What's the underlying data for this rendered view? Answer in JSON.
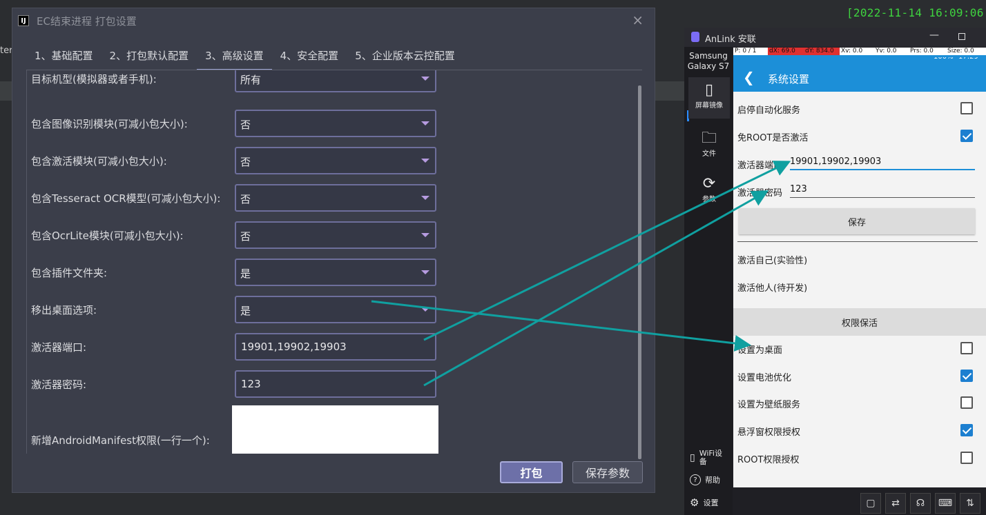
{
  "background": {
    "left_text": "ter",
    "timestamp": "[2022-11-14 16:09:06"
  },
  "dialog": {
    "icon_letter": "IJ",
    "title": "EC结束进程 打包设置",
    "close": "×",
    "tabs": [
      {
        "label": "1、基础配置"
      },
      {
        "label": "2、打包默认配置"
      },
      {
        "label": "3、高级设置"
      },
      {
        "label": "4、安全配置"
      },
      {
        "label": "5、企业版本云控配置"
      }
    ],
    "fields": {
      "target": {
        "label": "目标机型(模拟器或者手机):",
        "value": "所有"
      },
      "image_module": {
        "label": "包含图像识别模块(可减小包大小):",
        "value": "否"
      },
      "activate_module": {
        "label": "包含激活模块(可减小包大小):",
        "value": "否"
      },
      "tesseract": {
        "label": "包含Tesseract OCR模型(可减小包大小):",
        "value": "否"
      },
      "ocrlite": {
        "label": "包含OcrLite模块(可减小包大小):",
        "value": "否"
      },
      "plugin_folder": {
        "label": "包含插件文件夹:",
        "value": "是"
      },
      "remove_desktop": {
        "label": "移出桌面选项:",
        "value": "是"
      },
      "activator_port": {
        "label": "激活器端口:",
        "value": "19901,19902,19903"
      },
      "activator_password": {
        "label": "激活器密码:",
        "value": "123"
      },
      "manifest": {
        "label": "新增AndroidManifest权限(一行一个):",
        "value": ""
      }
    },
    "buttons": {
      "pack": "打包",
      "save_params": "保存参数"
    }
  },
  "anlink": {
    "title": "AnLink 安联",
    "minimize": "—",
    "device_name": "Samsung Galaxy S7",
    "sidebar": [
      {
        "label": "屏幕镜像",
        "icon": "phone-icon"
      },
      {
        "label": "文件",
        "icon": "folder-icon"
      },
      {
        "label": "参数",
        "icon": "refresh-icon"
      }
    ],
    "sidebar_bottom": [
      {
        "label": "WiFi设备",
        "icon": "wifi-device-icon"
      },
      {
        "label": "帮助",
        "icon": "help-icon"
      },
      {
        "label": "设置",
        "icon": "settings-icon"
      }
    ],
    "phone": {
      "pointer_bar": [
        "P: 0 / 1",
        "dX: 69.0",
        "dY: 834.0",
        "Xv: 0.0",
        "Yv: 0.0",
        "Prs: 0.0",
        "Size: 0.0"
      ],
      "status_battery": "100%",
      "status_time": "17:29",
      "header_title": "系统设置",
      "rows": {
        "auto_service": {
          "label": "启停自动化服务",
          "checked": false
        },
        "root_free": {
          "label": "免ROOT是否激活",
          "checked": true
        },
        "port": {
          "label": "激活器端口",
          "value": "19901,19902,19903"
        },
        "password": {
          "label": "激活器密码",
          "value": "123"
        },
        "save": "保存",
        "self_activate": "激活自己(实验性)",
        "other_activate": "激活他人(待开发)",
        "section": "权限保活",
        "set_desktop": {
          "label": "设置为桌面",
          "checked": false
        },
        "battery_opt": {
          "label": "设置电池优化",
          "checked": true
        },
        "wallpaper": {
          "label": "设置为壁纸服务",
          "checked": false
        },
        "overlay": {
          "label": "悬浮窗权限授权",
          "checked": true
        },
        "root": {
          "label": "ROOT权限授权",
          "checked": false
        }
      }
    },
    "arrow_color": "#10a0a0"
  }
}
